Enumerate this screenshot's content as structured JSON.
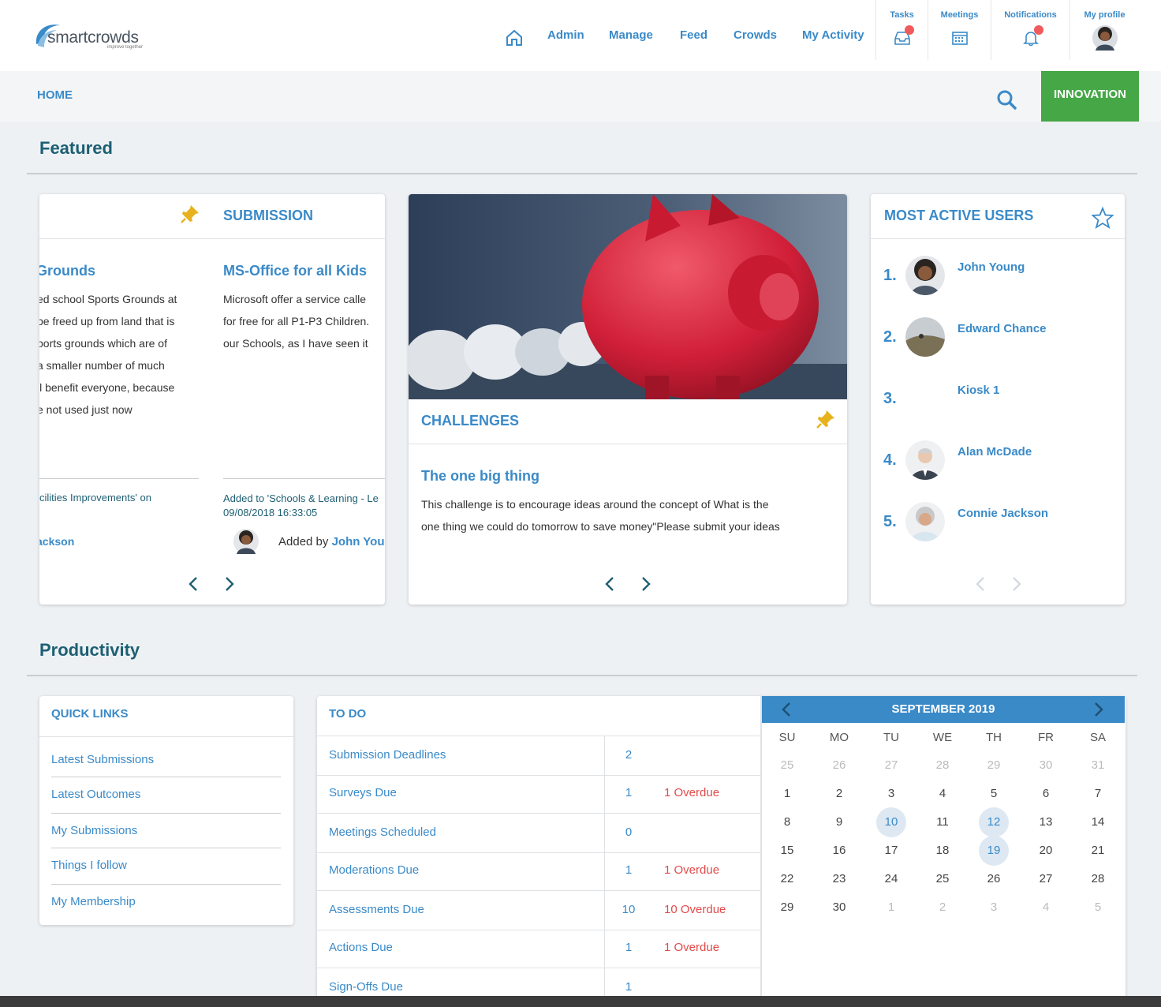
{
  "header": {
    "logo_word": "smartcrowds",
    "logo_tagline": "improve together",
    "nav": [
      {
        "label": "Admin"
      },
      {
        "label": "Manage"
      },
      {
        "label": "Feed"
      },
      {
        "label": "Crowds"
      },
      {
        "label": "My Activity"
      }
    ],
    "tasks_label": "Tasks",
    "meetings_label": "Meetings",
    "notifications_label": "Notifications",
    "profile_label": "My profile"
  },
  "subnav": {
    "crumb": "HOME",
    "innovation": "INNOVATION"
  },
  "featured": {
    "heading": "Featured",
    "submission": {
      "type": "SUBMISSION",
      "left_title": "Grounds",
      "left_body": [
        "ed school Sports Grounds at",
        "be freed up from land that is",
        "ports grounds which are of",
        "a smaller number of much",
        "ll benefit everyone, because",
        "e not used just now"
      ],
      "left_meta": "cilities Improvements' on",
      "left_author": "ackson",
      "title": "MS-Office for all Kids",
      "body": [
        "Microsoft offer a service calle",
        "for free for all P1-P3 Children.",
        "our Schools, as I have seen it"
      ],
      "meta_line1": "Added to 'Schools & Learning - Le",
      "meta_line2": "09/08/2018 16:33:05",
      "added_by_prefix": "Added by ",
      "added_by_name": "John You"
    },
    "challenge": {
      "type": "CHALLENGES",
      "title": "The one big thing",
      "body": [
        "This challenge is to encourage ideas around the concept of What is the",
        "one thing we could do tomorrow to save money\"Please submit your ideas"
      ]
    },
    "active_users": {
      "heading": "MOST ACTIVE USERS",
      "users": [
        {
          "rank": "1.",
          "name": "John Young"
        },
        {
          "rank": "2.",
          "name": "Edward Chance"
        },
        {
          "rank": "3.",
          "name": "Kiosk 1"
        },
        {
          "rank": "4.",
          "name": "Alan McDade"
        },
        {
          "rank": "5.",
          "name": "Connie Jackson"
        }
      ]
    }
  },
  "productivity": {
    "heading": "Productivity",
    "quick_links": {
      "heading": "QUICK LINKS",
      "items": [
        {
          "label": "Latest Submissions"
        },
        {
          "label": "Latest Outcomes"
        },
        {
          "label": "My Submissions"
        },
        {
          "label": "Things I follow"
        },
        {
          "label": "My Membership"
        }
      ]
    },
    "todo": {
      "heading": "TO DO",
      "rows": [
        {
          "name": "Submission Deadlines",
          "count": "2",
          "overdue": ""
        },
        {
          "name": "Surveys Due",
          "count": "1",
          "overdue": "1 Overdue"
        },
        {
          "name": "Meetings Scheduled",
          "count": "0",
          "overdue": ""
        },
        {
          "name": "Moderations Due",
          "count": "1",
          "overdue": "1 Overdue"
        },
        {
          "name": "Assessments Due",
          "count": "10",
          "overdue": "10 Overdue"
        },
        {
          "name": "Actions Due",
          "count": "1",
          "overdue": "1 Overdue"
        },
        {
          "name": "Sign-Offs Due",
          "count": "1",
          "overdue": ""
        }
      ]
    },
    "calendar": {
      "month": "SEPTEMBER 2019",
      "weekdays": [
        "SU",
        "MO",
        "TU",
        "WE",
        "TH",
        "FR",
        "SA"
      ],
      "weeks": [
        [
          "25",
          "26",
          "27",
          "28",
          "29",
          "30",
          "31"
        ],
        [
          "1",
          "2",
          "3",
          "4",
          "5",
          "6",
          "7"
        ],
        [
          "8",
          "9",
          "10",
          "11",
          "12",
          "13",
          "14"
        ],
        [
          "15",
          "16",
          "17",
          "18",
          "19",
          "20",
          "21"
        ],
        [
          "22",
          "23",
          "24",
          "25",
          "26",
          "27",
          "28"
        ],
        [
          "29",
          "30",
          "1",
          "2",
          "3",
          "4",
          "5"
        ]
      ],
      "highlighted": [
        "10",
        "12",
        "19"
      ]
    }
  },
  "colors": {
    "accent": "#3a8ac8",
    "heading": "#1d5f73",
    "innovation": "#45a746",
    "overdue": "#e24a4a",
    "pin": "#e8b21e"
  }
}
